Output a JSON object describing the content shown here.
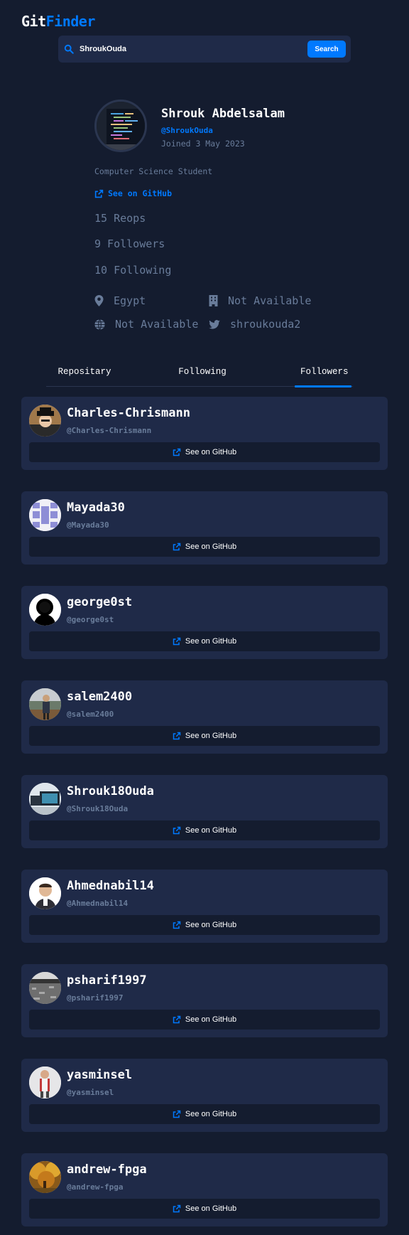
{
  "logo": {
    "part1": "Git",
    "part2": "Finder"
  },
  "search": {
    "value": "ShroukOuda",
    "placeholder": "Search GitHub username...",
    "button_label": "Search"
  },
  "profile": {
    "name": "Shrouk Abdelsalam",
    "login": "@ShroukOuda",
    "joined": "Joined 3 May 2023",
    "bio": "Computer Science Student",
    "github_link": "See on GitHub",
    "repos": "15 Reops",
    "followers": "9 Followers",
    "following": "10 Following",
    "location": "Egypt",
    "company": "Not Available",
    "blog": "Not Available",
    "twitter": "shroukouda2"
  },
  "tabs": [
    {
      "label": "Repositary",
      "active": false
    },
    {
      "label": "Following",
      "active": false
    },
    {
      "label": "Followers",
      "active": true
    }
  ],
  "followers": [
    {
      "name": "Charles-Chrismann",
      "login": "@Charles-Chrismann",
      "button": "See on GitHub"
    },
    {
      "name": "Mayada30",
      "login": "@Mayada30",
      "button": "See on GitHub"
    },
    {
      "name": "george0st",
      "login": "@george0st",
      "button": "See on GitHub"
    },
    {
      "name": "salem2400",
      "login": "@salem2400",
      "button": "See on GitHub"
    },
    {
      "name": "Shrouk18Ouda",
      "login": "@Shrouk18Ouda",
      "button": "See on GitHub"
    },
    {
      "name": "Ahmednabil14",
      "login": "@Ahmednabil14",
      "button": "See on GitHub"
    },
    {
      "name": "psharif1997",
      "login": "@psharif1997",
      "button": "See on GitHub"
    },
    {
      "name": "yasminsel",
      "login": "@yasminsel",
      "button": "See on GitHub"
    },
    {
      "name": "andrew-fpga",
      "login": "@andrew-fpga",
      "button": "See on GitHub"
    }
  ],
  "colors": {
    "background": "#141c2f",
    "card": "#1f2a48",
    "accent": "#0079ff",
    "muted": "#697c9a"
  }
}
